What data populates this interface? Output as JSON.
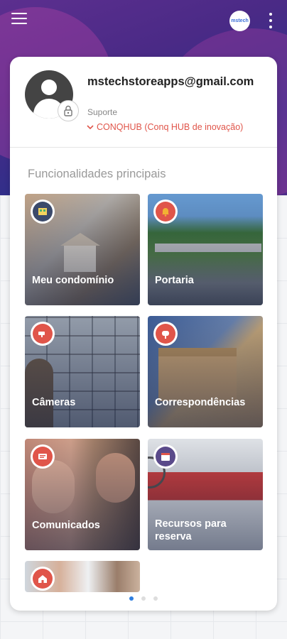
{
  "header": {
    "brand": "mstech",
    "colors": {
      "hero": "#4a2a86",
      "accent": "#e0554a",
      "active_dot": "#2f7fe0"
    }
  },
  "profile": {
    "email": "mstechstoreapps@gmail.com",
    "role": "Suporte",
    "organization": "CONQHUB (Conq HUB de inovação)"
  },
  "section_title": "Funcionalidades principais",
  "tiles": [
    {
      "label": "Meu condomínio",
      "icon": "building-icon"
    },
    {
      "label": "Portaria",
      "icon": "bell-icon"
    },
    {
      "label": "Câmeras",
      "icon": "camera-icon"
    },
    {
      "label": "Correspondências",
      "icon": "mailbox-icon"
    },
    {
      "label": "Comunicados",
      "icon": "message-icon"
    },
    {
      "label": "Recursos para reserva",
      "icon": "calendar-icon"
    },
    {
      "label": "",
      "icon": "home-icon"
    }
  ],
  "pagination": {
    "pages": 3,
    "current": 1
  }
}
